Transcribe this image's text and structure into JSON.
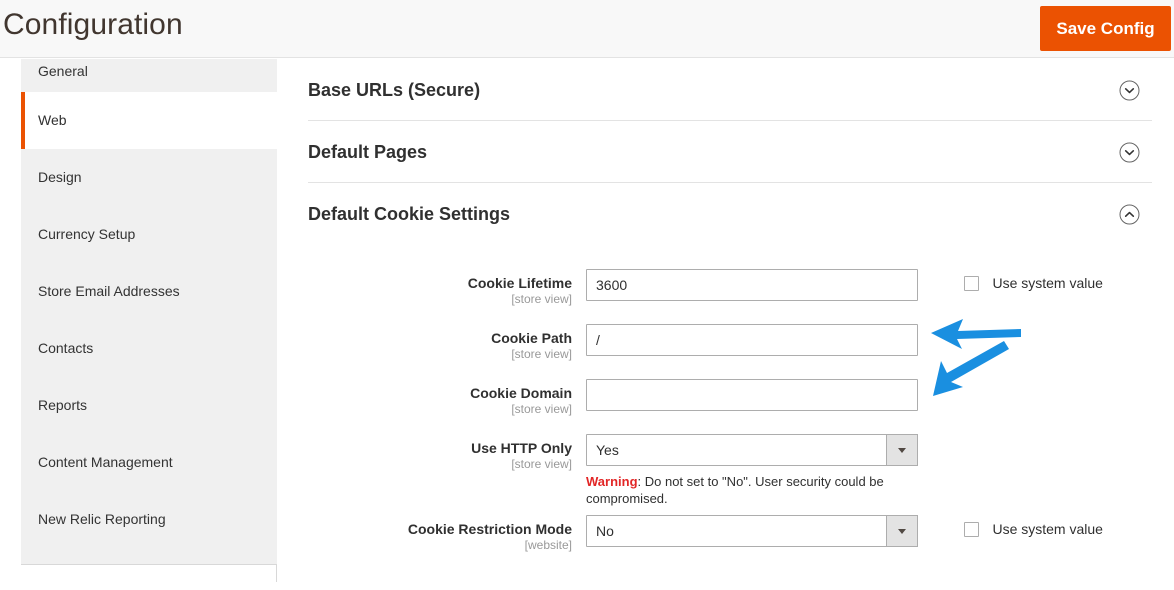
{
  "header": {
    "title": "Configuration",
    "save_label": "Save Config"
  },
  "sidebar": {
    "items": [
      {
        "label": "General",
        "active": false
      },
      {
        "label": "Web",
        "active": true
      },
      {
        "label": "Design",
        "active": false
      },
      {
        "label": "Currency Setup",
        "active": false
      },
      {
        "label": "Store Email Addresses",
        "active": false
      },
      {
        "label": "Contacts",
        "active": false
      },
      {
        "label": "Reports",
        "active": false
      },
      {
        "label": "Content Management",
        "active": false
      },
      {
        "label": "New Relic Reporting",
        "active": false
      }
    ]
  },
  "sections": [
    {
      "title": "Base URLs (Secure)",
      "expanded": false,
      "icon": "chevron-down-icon"
    },
    {
      "title": "Default Pages",
      "expanded": false,
      "icon": "chevron-down-icon"
    },
    {
      "title": "Default Cookie Settings",
      "expanded": true,
      "icon": "chevron-up-icon"
    }
  ],
  "form": {
    "cookie_lifetime": {
      "label": "Cookie Lifetime",
      "scope": "[store view]",
      "value": "3600",
      "placeholder": "",
      "system_value_label": "Use system value",
      "system_value_checked": false
    },
    "cookie_path": {
      "label": "Cookie Path",
      "scope": "[store view]",
      "value": "/",
      "placeholder": ""
    },
    "cookie_domain": {
      "label": "Cookie Domain",
      "scope": "[store view]",
      "value": "",
      "placeholder": ""
    },
    "use_http_only": {
      "label": "Use HTTP Only",
      "scope": "[store view]",
      "value": "Yes",
      "options": [
        "Yes",
        "No"
      ],
      "note_warning_label": "Warning",
      "note_text": ": Do not set to \"No\". User security could be compromised."
    },
    "cookie_restriction_mode": {
      "label": "Cookie Restriction Mode",
      "scope": "[website]",
      "value": "No",
      "options": [
        "Yes",
        "No"
      ],
      "system_value_label": "Use system value",
      "system_value_checked": false
    }
  },
  "annotations": {
    "arrow_cookie_path": "arrow-pointing-left-at-cookie-path",
    "arrow_cookie_domain": "arrow-pointing-down-left-at-cookie-domain",
    "color": "#1a8fe0"
  },
  "colors": {
    "accent": "#eb5202",
    "warning": "#e22626",
    "annotation": "#1a8fe0"
  }
}
